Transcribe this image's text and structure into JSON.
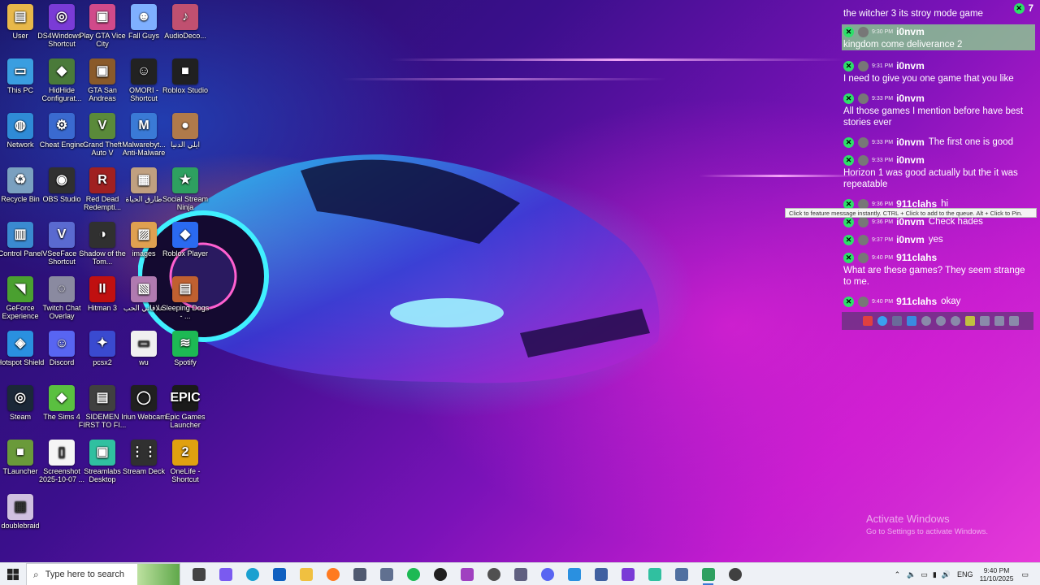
{
  "desktop_icons": [
    {
      "label": "User",
      "color": "#e8b84a",
      "glyph": "▤"
    },
    {
      "label": "DS4Windows - Shortcut",
      "color": "#7a3bd6",
      "glyph": "◎"
    },
    {
      "label": "Play GTA Vice City",
      "color": "#d04a8a",
      "glyph": "▣"
    },
    {
      "label": "Fall Guys",
      "color": "#7fb0ff",
      "glyph": "☻"
    },
    {
      "label": "AudioDeco...",
      "color": "#c05070",
      "glyph": "♪"
    },
    {
      "label": "This PC",
      "color": "#3a9ee0",
      "glyph": "▭"
    },
    {
      "label": "HidHide Configurat...",
      "color": "#4a7a3a",
      "glyph": "◆"
    },
    {
      "label": "GTA San Andreas",
      "color": "#8a5a2a",
      "glyph": "▣"
    },
    {
      "label": "OMORI - Shortcut",
      "color": "#222222",
      "glyph": "☺"
    },
    {
      "label": "Roblox Studio",
      "color": "#202020",
      "glyph": "■"
    },
    {
      "label": "Network",
      "color": "#2f8bd6",
      "glyph": "◍"
    },
    {
      "label": "Cheat Engine",
      "color": "#3a6ad0",
      "glyph": "⚙"
    },
    {
      "label": "Grand Theft Auto V",
      "color": "#5a8a3a",
      "glyph": "V"
    },
    {
      "label": "Malwarebyt... Anti-Malware",
      "color": "#3a7ad6",
      "glyph": "M"
    },
    {
      "label": "ايلي الدنيا",
      "color": "#b07a4a",
      "glyph": "●"
    },
    {
      "label": "Recycle Bin",
      "color": "#7aa0c0",
      "glyph": "♻"
    },
    {
      "label": "OBS Studio",
      "color": "#303030",
      "glyph": "◉"
    },
    {
      "label": "Red Dead Redempti...",
      "color": "#a02020",
      "glyph": "R"
    },
    {
      "label": "طارق الحياة",
      "color": "#c0a080",
      "glyph": "▦"
    },
    {
      "label": "Social Stream Ninja",
      "color": "#2ea060",
      "glyph": "★"
    },
    {
      "label": "Control Panel",
      "color": "#3a8ad0",
      "glyph": "▥"
    },
    {
      "label": "VSeeFace - Shortcut",
      "color": "#5a6ad0",
      "glyph": "V"
    },
    {
      "label": "Shadow of the Tom...",
      "color": "#303030",
      "glyph": "◑"
    },
    {
      "label": "images",
      "color": "#e0a050",
      "glyph": "▨"
    },
    {
      "label": "Roblox Player",
      "color": "#2a6af0",
      "glyph": "◆"
    },
    {
      "label": "GeForce Experience",
      "color": "#4aa030",
      "glyph": "◥"
    },
    {
      "label": "Twitch Chat Overlay",
      "color": "#8a8aa0",
      "glyph": "◌"
    },
    {
      "label": "Hitman 3",
      "color": "#c01010",
      "glyph": "II"
    },
    {
      "label": "علاقاتي الحب",
      "color": "#b07ab0",
      "glyph": "▧"
    },
    {
      "label": "Sleeping Dogs - ...",
      "color": "#c06030",
      "glyph": "▤"
    },
    {
      "label": "Hotspot Shield",
      "color": "#2a90e0",
      "glyph": "◈"
    },
    {
      "label": "Discord",
      "color": "#5865f2",
      "glyph": "☺"
    },
    {
      "label": "pcsx2",
      "color": "#3a4ad0",
      "glyph": "✦"
    },
    {
      "label": "wu",
      "color": "#f0f0f0",
      "glyph": "▭"
    },
    {
      "label": "Spotify",
      "color": "#1db954",
      "glyph": "≋"
    },
    {
      "label": "Steam",
      "color": "#1b2838",
      "glyph": "◎"
    },
    {
      "label": "The Sims 4",
      "color": "#5ac040",
      "glyph": "◆"
    },
    {
      "label": "SIDEMEN FIRST TO FI...",
      "color": "#404040",
      "glyph": "▤"
    },
    {
      "label": "Iriun Webcam",
      "color": "#202020",
      "glyph": "◯"
    },
    {
      "label": "Epic Games Launcher",
      "color": "#1a1a1a",
      "glyph": "EPIC"
    },
    {
      "label": "TLauncher",
      "color": "#6a9a3a",
      "glyph": "■"
    },
    {
      "label": "Screenshot 2025-10-07 ...",
      "color": "#f5f5f5",
      "glyph": "▯"
    },
    {
      "label": "Streamlabs Desktop",
      "color": "#30c0a0",
      "glyph": "▣"
    },
    {
      "label": "Stream Deck",
      "color": "#303030",
      "glyph": "⋮⋮"
    },
    {
      "label": "OneLife - Shortcut",
      "color": "#e0a010",
      "glyph": "2"
    },
    {
      "label": "doublebraid",
      "color": "#d0c0e0",
      "glyph": "▦"
    }
  ],
  "chat": {
    "count_badge": "7",
    "messages": [
      {
        "time": "",
        "user": "",
        "text": "the witcher 3 its stroy mode game",
        "inline": false
      },
      {
        "time": "9:30 PM",
        "user": "i0nvm",
        "text": "kingdom come deliverance 2",
        "inline": false,
        "highlight": true
      },
      {
        "time": "9:31 PM",
        "user": "i0nvm",
        "text": "I need to give you one game that you like",
        "inline": false
      },
      {
        "time": "9:33 PM",
        "user": "i0nvm",
        "text": "All those games I mention before have best stories ever",
        "inline": false
      },
      {
        "time": "9:33 PM",
        "user": "i0nvm",
        "text": "The first one is good",
        "inline": true
      },
      {
        "time": "9:33 PM",
        "user": "i0nvm",
        "text": "Horizon 1 was good actually but the it was repeatable",
        "inline": false
      },
      {
        "time": "9:36 PM",
        "user": "911clahs",
        "text": "hi",
        "inline": true
      },
      {
        "time": "9:36 PM",
        "user": "i0nvm",
        "text": "Check hades",
        "inline": true
      },
      {
        "time": "9:37 PM",
        "user": "i0nvm",
        "text": "yes",
        "inline": true
      },
      {
        "time": "9:40 PM",
        "user": "911clahs",
        "text": "What are these games? They seem strange to me.",
        "inline": false
      },
      {
        "time": "9:40 PM",
        "user": "911clahs",
        "text": "okay",
        "inline": true
      }
    ],
    "tooltip": "Click to feature message instantly. CTRL + Click to add to the queue. Alt + Click to Pin."
  },
  "watermark": {
    "title": "Activate Windows",
    "subtitle": "Go to Settings to activate Windows."
  },
  "taskbar": {
    "search_placeholder": "Type here to search",
    "apps": [
      {
        "name": "task-view",
        "color": "#444444"
      },
      {
        "name": "copilot",
        "color": "#7a5af0"
      },
      {
        "name": "edge",
        "color": "#1aa0d0"
      },
      {
        "name": "outlook",
        "color": "#1060c0"
      },
      {
        "name": "file-explorer",
        "color": "#f0c040"
      },
      {
        "name": "firefox",
        "color": "#ff7a20"
      },
      {
        "name": "calculator",
        "color": "#505a70"
      },
      {
        "name": "app-gray",
        "color": "#607090"
      },
      {
        "name": "spotify",
        "color": "#1db954"
      },
      {
        "name": "iriun",
        "color": "#202020"
      },
      {
        "name": "app-purple",
        "color": "#a040c0"
      },
      {
        "name": "obs",
        "color": "#505050"
      },
      {
        "name": "twitch-overlay",
        "color": "#606080"
      },
      {
        "name": "discord",
        "color": "#5865f2"
      },
      {
        "name": "hotspot",
        "color": "#2a90e0"
      },
      {
        "name": "app-blue",
        "color": "#4060a0"
      },
      {
        "name": "ds4windows",
        "color": "#7a3bd6"
      },
      {
        "name": "streamlabs",
        "color": "#30c0a0"
      },
      {
        "name": "app-window",
        "color": "#5070a0"
      },
      {
        "name": "social-stream",
        "color": "#2ea060",
        "active": true
      },
      {
        "name": "settings",
        "color": "#404040"
      }
    ],
    "language": "ENG",
    "time": "9:40 PM",
    "date": "11/10/2025"
  }
}
